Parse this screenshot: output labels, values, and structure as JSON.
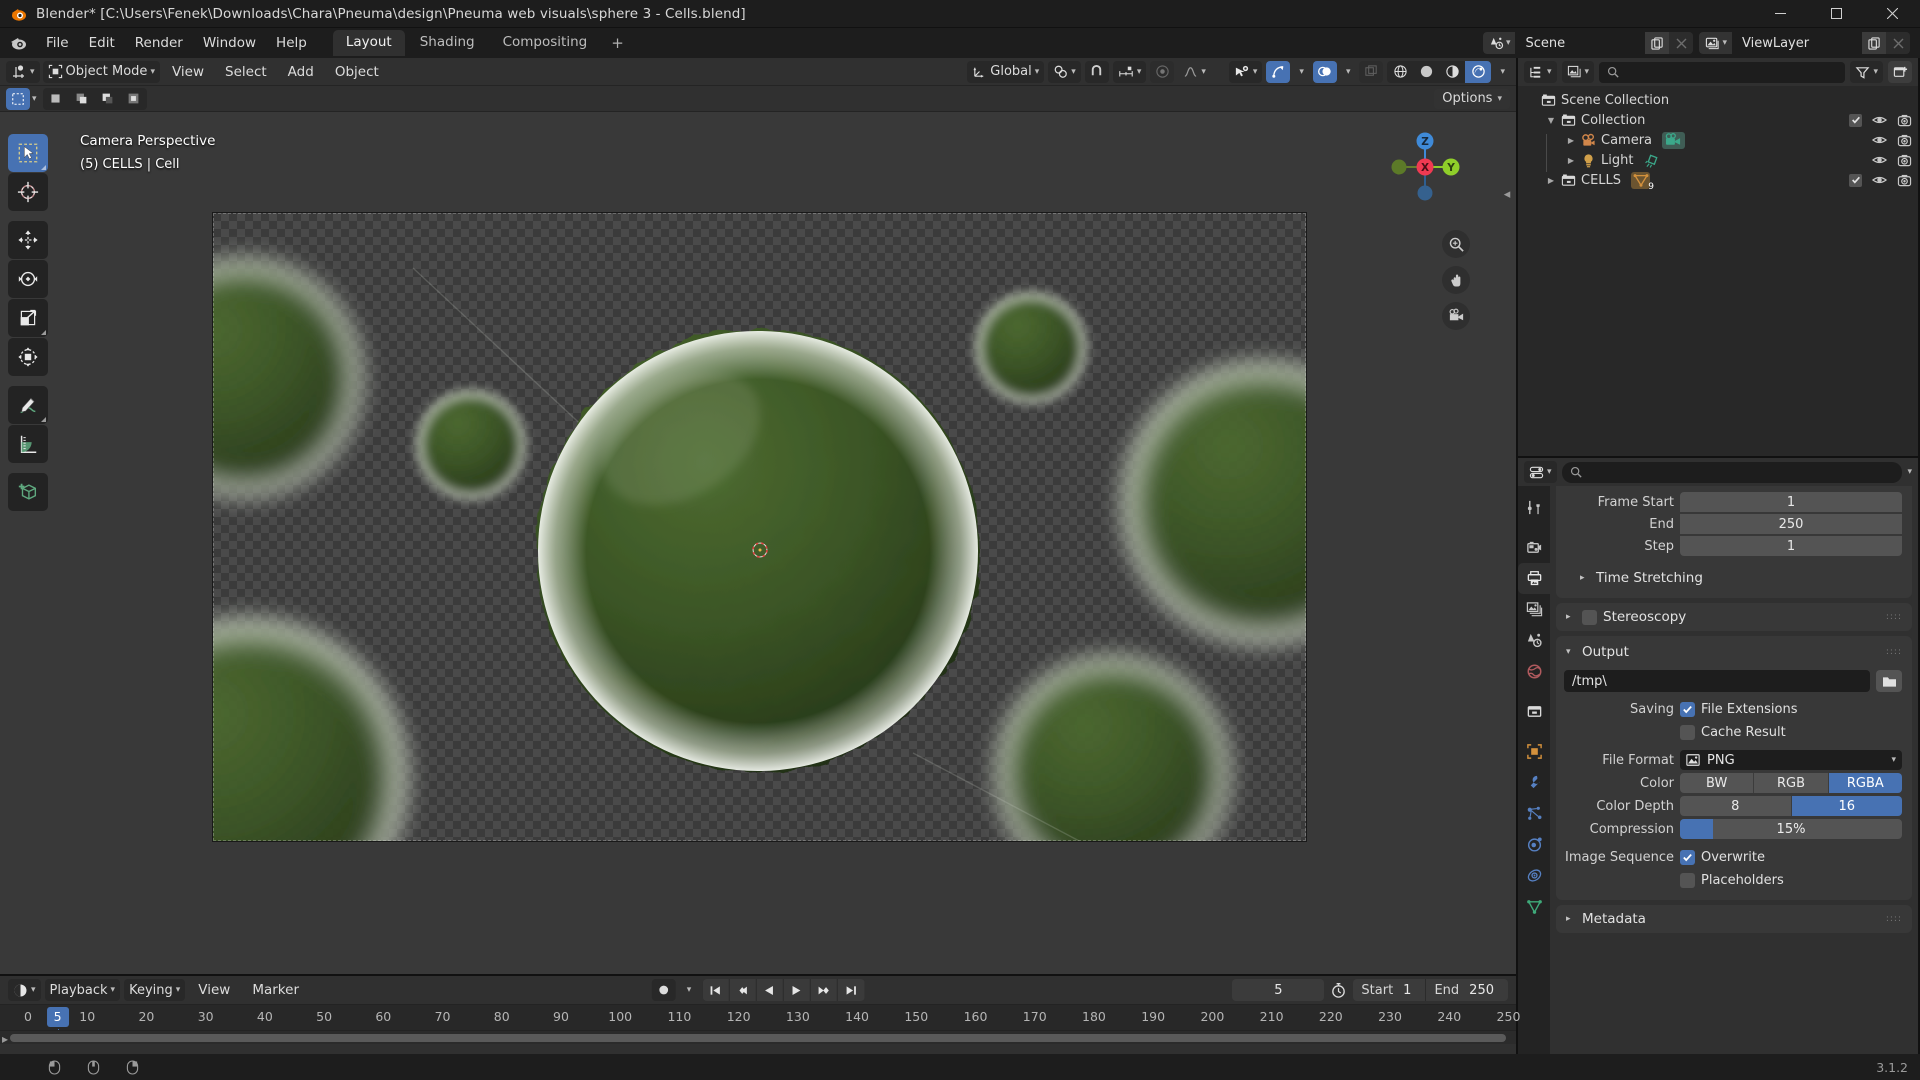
{
  "window": {
    "title": "Blender* [C:\\Users\\Fenek\\Downloads\\Chara\\Pneuma\\design\\Pneuma web visuals\\sphere 3 - Cells.blend]",
    "minimize": "—",
    "maximize": "❐",
    "close": "✕"
  },
  "topbar": {
    "menus": [
      "File",
      "Edit",
      "Render",
      "Window",
      "Help"
    ],
    "workspaces": [
      {
        "label": "Layout",
        "active": true
      },
      {
        "label": "Shading",
        "active": false
      },
      {
        "label": "Compositing",
        "active": false
      }
    ],
    "add_workspace": "+",
    "scene": {
      "name": "Scene"
    },
    "viewlayer": {
      "name": "ViewLayer"
    }
  },
  "viewport": {
    "mode": "Object Mode",
    "menus": [
      "View",
      "Select",
      "Add",
      "Object"
    ],
    "transform_orientation": "Global",
    "options_label": "Options",
    "overlay_line1": "Camera Perspective",
    "overlay_line2": "(5) CELLS | Cell",
    "gizmo_axes": [
      {
        "label": "Z",
        "color": "#3f8ad8"
      },
      {
        "label": "Y",
        "color": "#8fce2a"
      },
      {
        "label": "X",
        "color": "#f03a52"
      }
    ],
    "tools": [
      "tweak-select-tool",
      "cursor-tool",
      "move-tool",
      "rotate-tool",
      "scale-tool",
      "transform-tool",
      "annotate-tool",
      "measure-tool",
      "add-cube-tool"
    ]
  },
  "outliner": {
    "search_placeholder": "",
    "rows": [
      {
        "name": "Scene Collection",
        "indent": 0,
        "icon": "collection-icon",
        "disclosure": "none",
        "checkbox": false,
        "eye": false,
        "camera": false
      },
      {
        "name": "Collection",
        "indent": 1,
        "icon": "collection-icon",
        "disclosure": "open",
        "checkbox": true,
        "eye": true,
        "camera": true
      },
      {
        "name": "Camera",
        "indent": 2,
        "icon": "camera-data-icon",
        "disclosure": "closed",
        "checkbox": false,
        "eye": true,
        "camera": true,
        "badge": "camera-object-icon"
      },
      {
        "name": "Light",
        "indent": 2,
        "icon": "light-data-icon",
        "disclosure": "closed",
        "checkbox": false,
        "eye": true,
        "camera": true,
        "badge": "light-object-icon"
      },
      {
        "name": "CELLS",
        "indent": 1,
        "icon": "collection-icon",
        "disclosure": "closed",
        "checkbox": true,
        "eye": true,
        "camera": true,
        "badge": "mesh-icon",
        "badge_count": "9"
      }
    ]
  },
  "properties": {
    "search_placeholder": "",
    "tabs": [
      "tool-tab",
      "render-tab",
      "output-tab",
      "view-layer-tab",
      "scene-tab",
      "world-tab",
      "collection-tab",
      "object-tab",
      "modifier-tab",
      "particles-tab",
      "physics-tab",
      "constraints-tab",
      "data-tab"
    ],
    "active_tab": "output-tab",
    "frame_range": {
      "frame_start_label": "Frame Start",
      "frame_start_value": "1",
      "end_label": "End",
      "end_value": "250",
      "step_label": "Step",
      "step_value": "1"
    },
    "time_stretching_label": "Time Stretching",
    "stereoscopy_label": "Stereoscopy",
    "output": {
      "header": "Output",
      "path": "/tmp\\",
      "saving_label": "Saving",
      "file_extensions_label": "File Extensions",
      "file_extensions_checked": true,
      "cache_result_label": "Cache Result",
      "cache_result_checked": false,
      "file_format_label": "File Format",
      "file_format_value": "PNG",
      "color_label": "Color",
      "color_options": [
        "BW",
        "RGB",
        "RGBA"
      ],
      "color_selected": "RGBA",
      "color_depth_label": "Color Depth",
      "color_depth_options": [
        "8",
        "16"
      ],
      "color_depth_selected": "16",
      "compression_label": "Compression",
      "compression_value": "15%",
      "compression_percent": 15,
      "image_sequence_label": "Image Sequence",
      "overwrite_label": "Overwrite",
      "overwrite_checked": true,
      "placeholders_label": "Placeholders",
      "placeholders_checked": false
    },
    "metadata_label": "Metadata"
  },
  "timeline": {
    "menus": [
      "Playback",
      "Keying",
      "View",
      "Marker"
    ],
    "current_frame": "5",
    "start_label": "Start",
    "start_value": "1",
    "end_label": "End",
    "end_value": "250",
    "ruler_ticks": [
      0,
      5,
      10,
      20,
      30,
      40,
      50,
      60,
      70,
      80,
      90,
      100,
      110,
      120,
      130,
      140,
      150,
      160,
      170,
      180,
      190,
      200,
      210,
      220,
      230,
      240,
      250
    ],
    "playhead_frame": 5,
    "ruler_min": 0,
    "ruler_max": 256
  },
  "statusbar": {
    "version": "3.1.2"
  },
  "colors": {
    "accent": "#4772b3",
    "panel": "#383838",
    "background": "#303030",
    "dark": "#1d1d1d",
    "axis_x": "#f03a52",
    "axis_y": "#8fce2a",
    "axis_z": "#3f8ad8"
  }
}
